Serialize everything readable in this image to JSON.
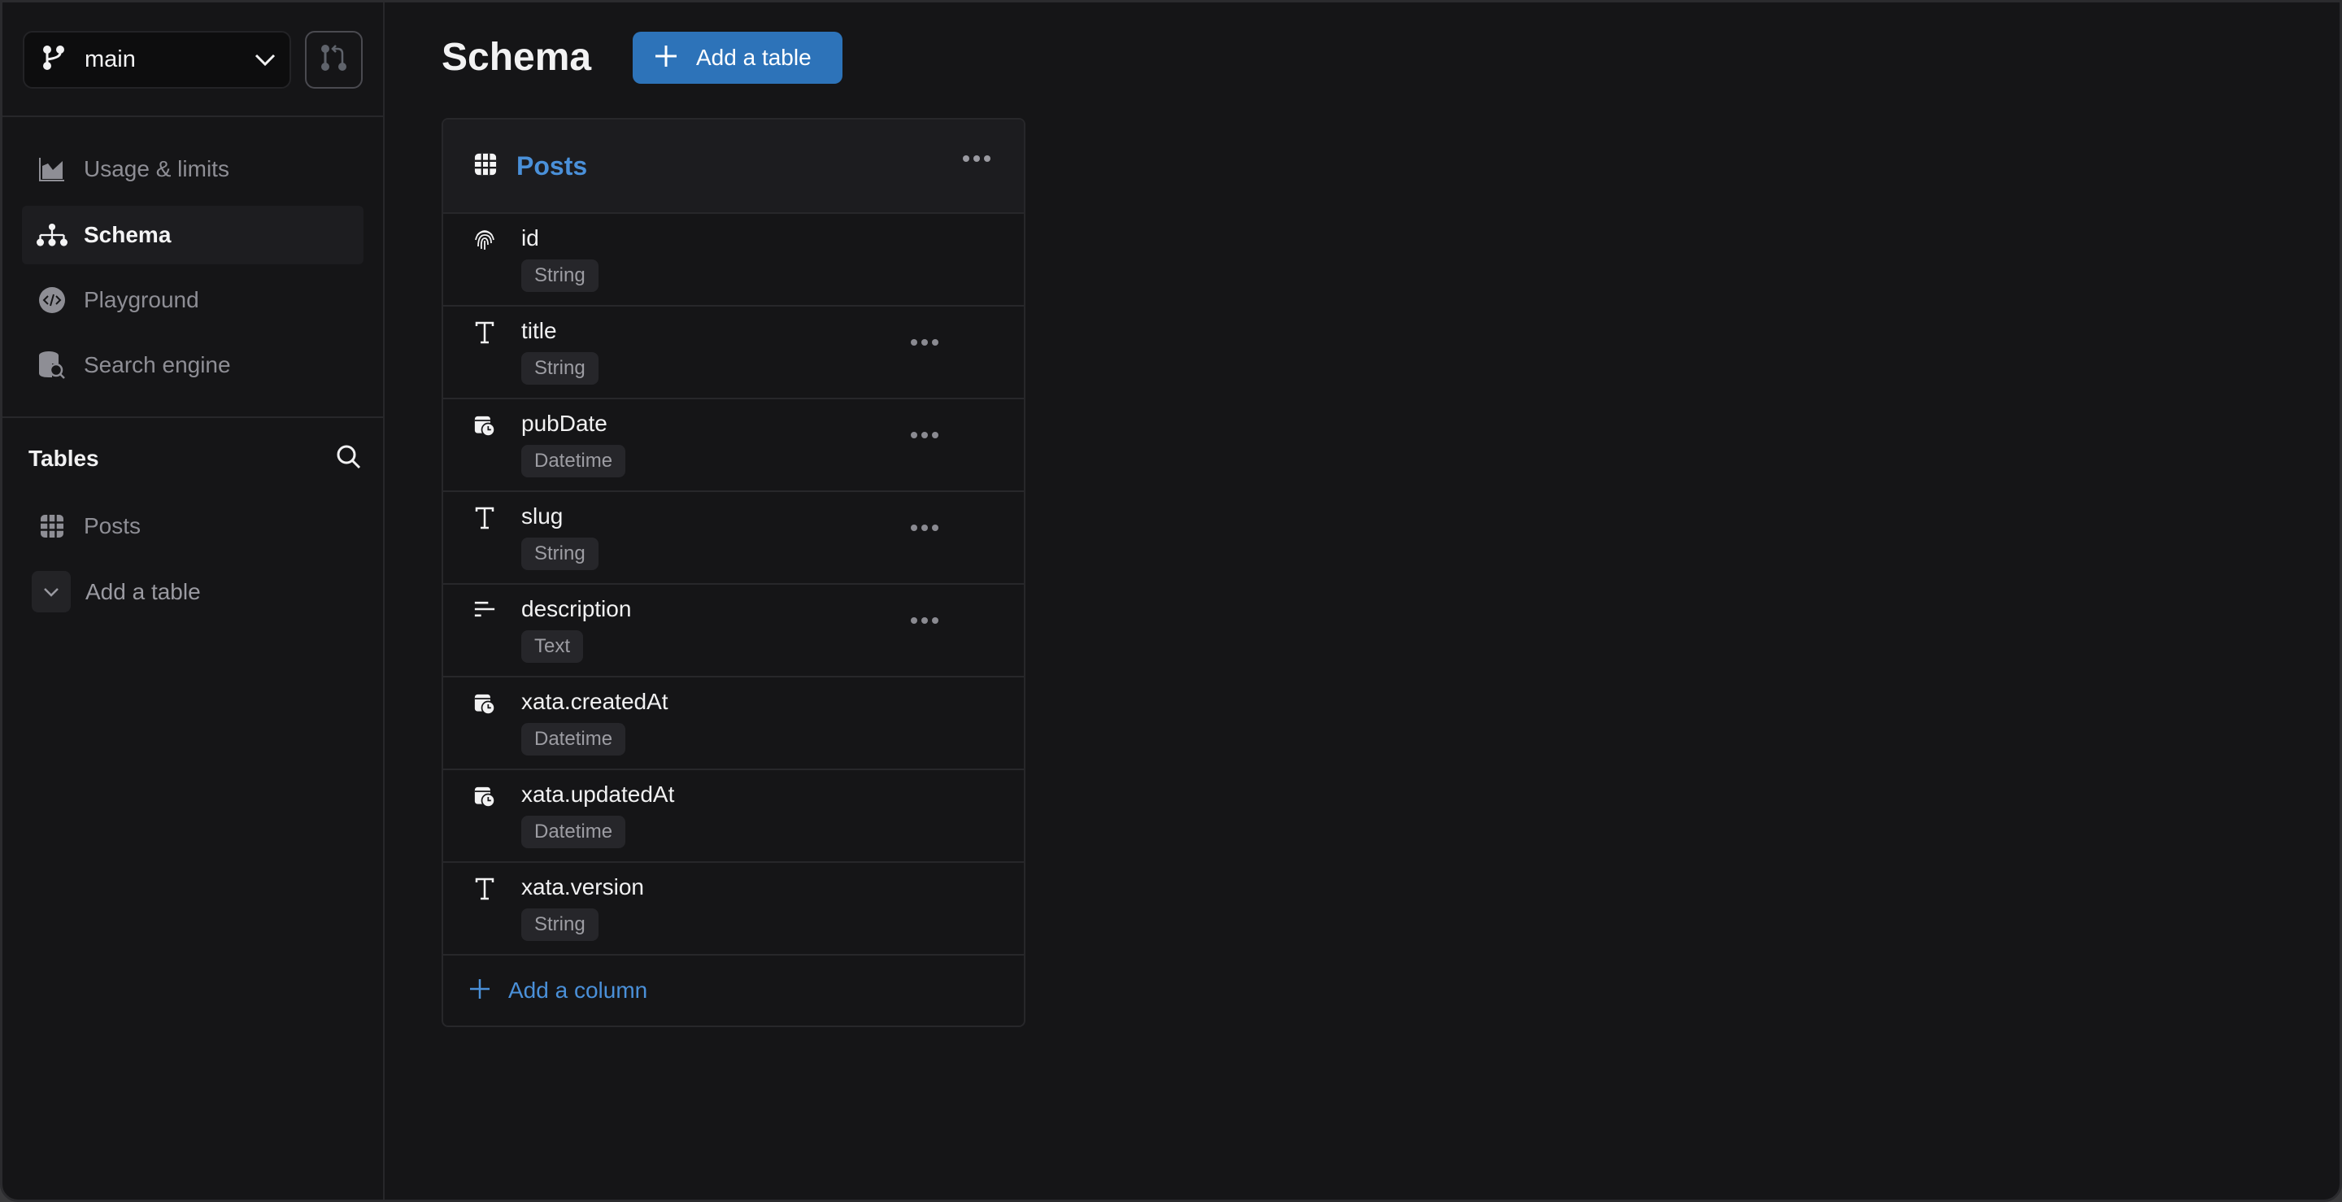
{
  "sidebar": {
    "branch": {
      "label": "main",
      "icon": "git-branch-icon"
    },
    "pr_button": {
      "icon": "git-pull-request-icon"
    },
    "nav": [
      {
        "label": "Usage & limits",
        "icon": "chart-area-icon",
        "active": false
      },
      {
        "label": "Schema",
        "icon": "sitemap-icon",
        "active": true
      },
      {
        "label": "Playground",
        "icon": "code-circle-icon",
        "active": false
      },
      {
        "label": "Search engine",
        "icon": "database-search-icon",
        "active": false
      }
    ],
    "tables_title": "Tables",
    "tables": [
      {
        "label": "Posts",
        "icon": "table-grid-icon"
      }
    ],
    "add_table_label": "Add a table"
  },
  "main": {
    "title": "Schema",
    "add_table_button": "Add a table",
    "table": {
      "name": "Posts",
      "columns": [
        {
          "name": "id",
          "type": "String",
          "icon": "fingerprint-icon",
          "menu": false
        },
        {
          "name": "title",
          "type": "String",
          "icon": "text-type-icon",
          "menu": true
        },
        {
          "name": "pubDate",
          "type": "Datetime",
          "icon": "calendar-clock-icon",
          "menu": true
        },
        {
          "name": "slug",
          "type": "String",
          "icon": "text-type-icon",
          "menu": true
        },
        {
          "name": "description",
          "type": "Text",
          "icon": "long-text-icon",
          "menu": true
        },
        {
          "name": "xata.createdAt",
          "type": "Datetime",
          "icon": "calendar-clock-icon",
          "menu": false
        },
        {
          "name": "xata.updatedAt",
          "type": "Datetime",
          "icon": "calendar-clock-icon",
          "menu": false
        },
        {
          "name": "xata.version",
          "type": "String",
          "icon": "text-type-icon",
          "menu": false
        }
      ],
      "add_column_label": "Add a column"
    }
  },
  "colors": {
    "accent": "#2d73b9",
    "link": "#4a90d9",
    "background": "#151517"
  }
}
